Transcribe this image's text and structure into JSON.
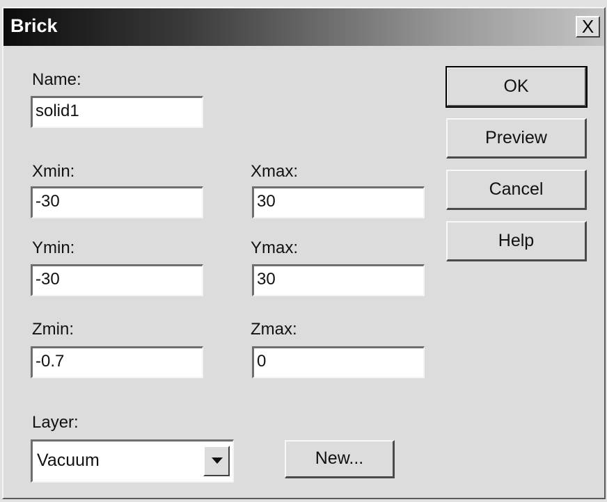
{
  "window": {
    "title": "Brick",
    "close_label": "X"
  },
  "form": {
    "name": {
      "label": "Name:",
      "value": "solid1"
    },
    "xmin": {
      "label": "Xmin:",
      "value": "-30"
    },
    "xmax": {
      "label": "Xmax:",
      "value": "30"
    },
    "ymin": {
      "label": "Ymin:",
      "value": "-30"
    },
    "ymax": {
      "label": "Ymax:",
      "value": "30"
    },
    "zmin": {
      "label": "Zmin:",
      "value": "-0.7"
    },
    "zmax": {
      "label": "Zmax:",
      "value": "0"
    },
    "layer": {
      "label": "Layer:",
      "value": "Vacuum"
    }
  },
  "buttons": {
    "ok": "OK",
    "preview": "Preview",
    "cancel": "Cancel",
    "help": "Help",
    "new": "New..."
  }
}
